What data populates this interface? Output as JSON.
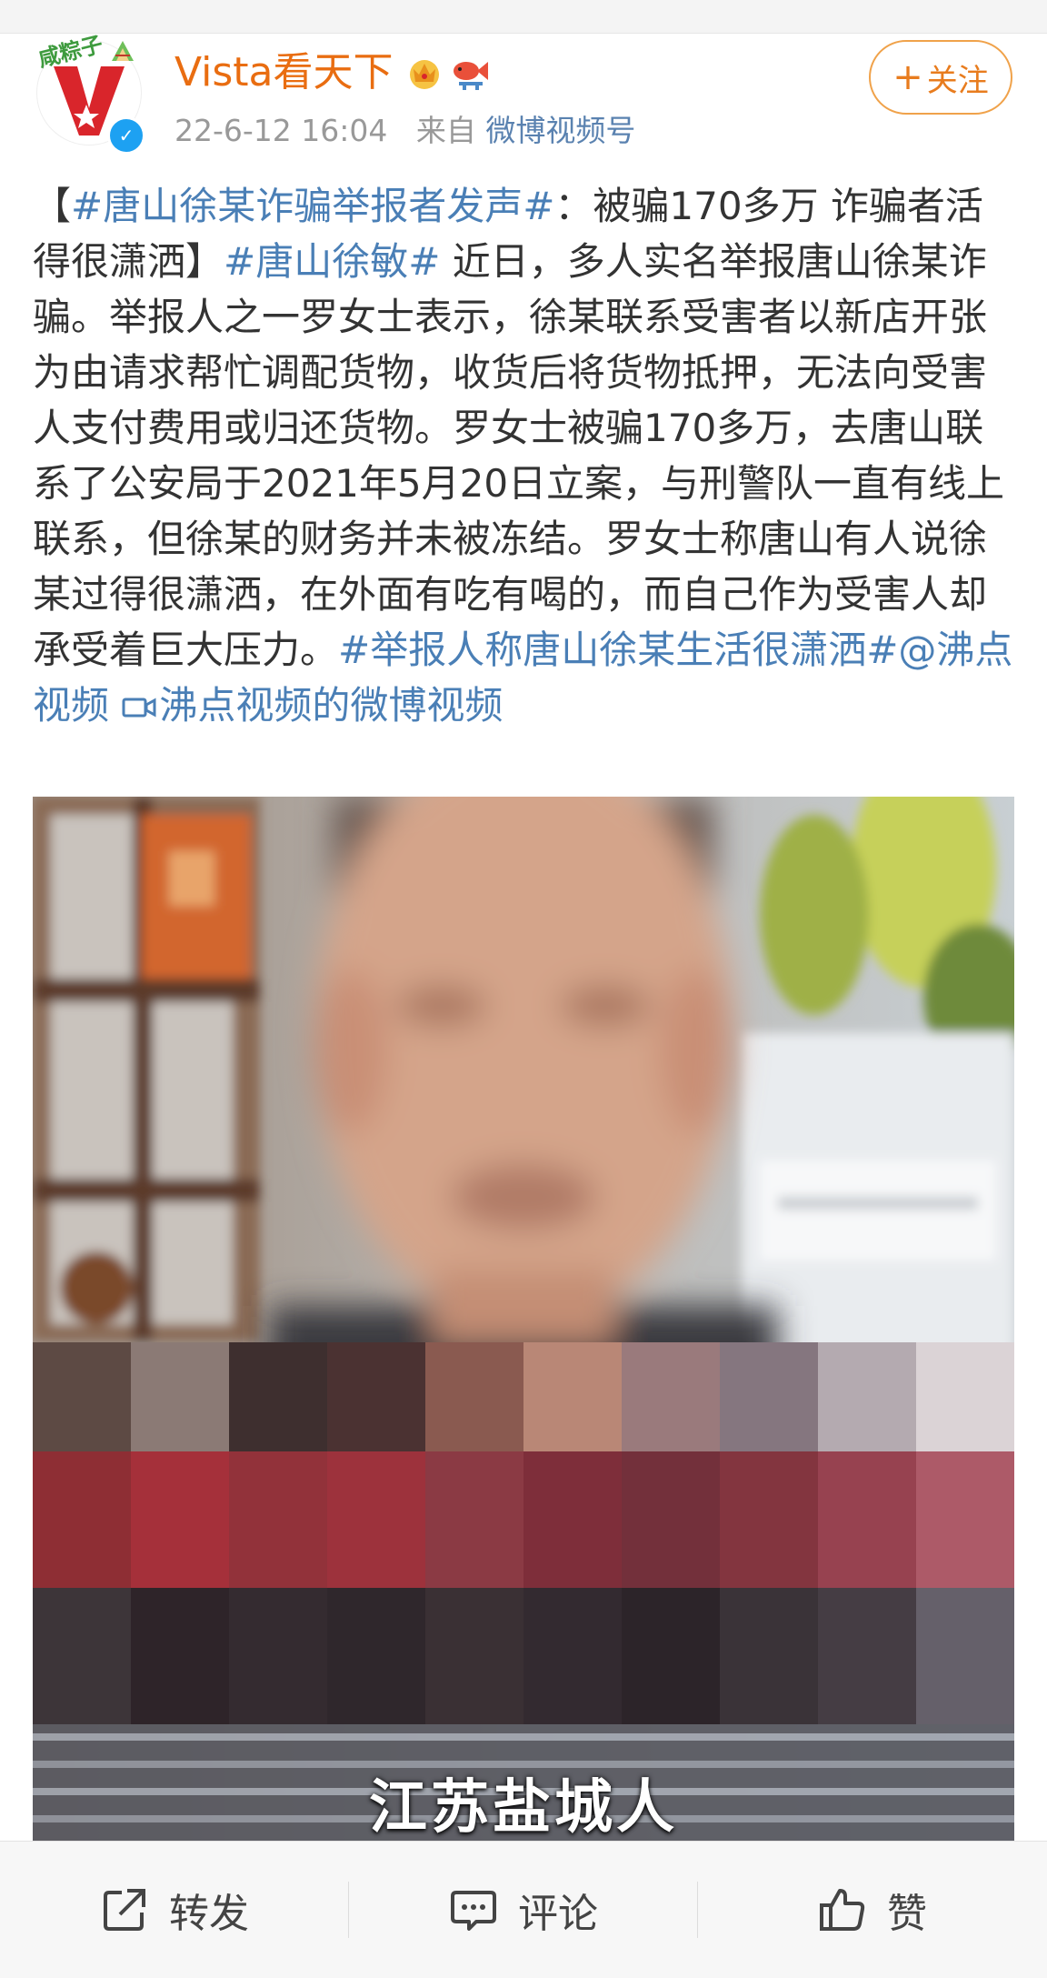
{
  "header": {
    "avatar_sticker_text": "咸粽子",
    "username": "Vista看天下",
    "timestamp": "22-6-12 16:04",
    "source_prefix": "来自",
    "source": "微博视频号",
    "follow_label": "关注",
    "badges": [
      "crown-badge-icon",
      "fish-badge-icon"
    ]
  },
  "post": {
    "segments": [
      {
        "text": "【",
        "link": false
      },
      {
        "text": "#唐山徐某诈骗举报者发声#",
        "link": true
      },
      {
        "text": "：被骗170多万 诈骗者活得很潇洒】",
        "link": false
      },
      {
        "text": "#唐山徐敏#",
        "link": true
      },
      {
        "text": " 近日，多人实名举报唐山徐某诈骗。举报人之一罗女士表示，徐某联系受害者以新店开张为由请求帮忙调配货物，收货后将货物抵押，无法向受害人支付费用或归还货物。罗女士被骗170多万，去唐山联系了公安局于2021年5月20日立案，与刑警队一直有线上联系，但徐某的财务并未被冻结。罗女士称唐山有人说徐某过得很潇洒，在外面有吃有喝的，而自己作为受害人却承受着巨大压力。",
        "link": false
      },
      {
        "text": "#举报人称唐山徐某生活很潇洒#",
        "link": true
      },
      {
        "text": "@沸点视频",
        "link": true
      },
      {
        "text": " ",
        "link": false
      },
      {
        "text": "沸点视频的微博视频",
        "link": true,
        "icon": "video-link-icon"
      }
    ]
  },
  "video": {
    "caption": "江苏盐城人"
  },
  "actions": {
    "repost_label": "转发",
    "comment_label": "评论",
    "like_label": "赞"
  },
  "colors": {
    "username": "#e96d11",
    "link": "#4a7fb6",
    "meta": "#999999",
    "follow": "#e87c1e"
  }
}
